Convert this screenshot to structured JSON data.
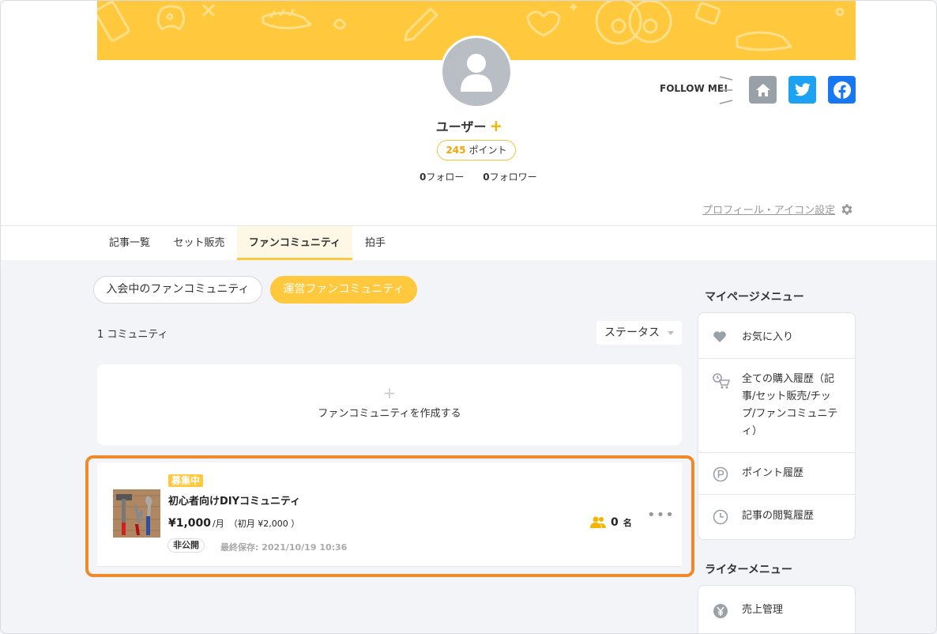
{
  "header": {
    "username": "ユーザー",
    "username_plus": "+",
    "points_value": "245",
    "points_label": "ポイント",
    "follow_count": "0",
    "follow_label": "フォロー",
    "follower_count": "0",
    "follower_label": "フォロワー",
    "follow_me": "FOLLOW ME!",
    "profile_settings": "プロフィール・アイコン設定"
  },
  "tabs": [
    {
      "label": "記事一覧"
    },
    {
      "label": "セット販売"
    },
    {
      "label": "ファンコミュニティ"
    },
    {
      "label": "拍手"
    }
  ],
  "filters": {
    "joined": "入会中のファンコミュニティ",
    "managed": "運営ファンコミュニティ"
  },
  "list": {
    "count": "1 コミュニティ",
    "status_select": "ステータス",
    "create_plus": "+",
    "create_label": "ファンコミュニティを作成する"
  },
  "community": {
    "badge": "募集中",
    "title": "初心者向けDIYコミュニティ",
    "price": "¥1,000",
    "price_unit": "/月",
    "first_month": "（初月 ¥2,000 ）",
    "visibility": "非公開",
    "last_saved": "最終保存: 2021/10/19 10:36",
    "members": "0",
    "members_unit": "名",
    "more": "•••"
  },
  "sidebar": {
    "mypage_heading": "マイページメニュー",
    "mypage_items": [
      {
        "label": "お気に入り",
        "icon": "heart-icon"
      },
      {
        "label": "全ての購入履歴（記事/セット販売/チップ/ファンコミュニティ）",
        "icon": "cart-clock-icon"
      },
      {
        "label": "ポイント履歴",
        "icon": "point-icon"
      },
      {
        "label": "記事の閲覧履歴",
        "icon": "clock-icon"
      }
    ],
    "writer_heading": "ライターメニュー",
    "writer_items": [
      {
        "label": "売上管理",
        "icon": "yen-icon"
      }
    ]
  },
  "colors": {
    "accent": "#ffc83d",
    "highlight": "#ee8a2a",
    "twitter": "#1da1f2",
    "facebook": "#1877f2"
  }
}
